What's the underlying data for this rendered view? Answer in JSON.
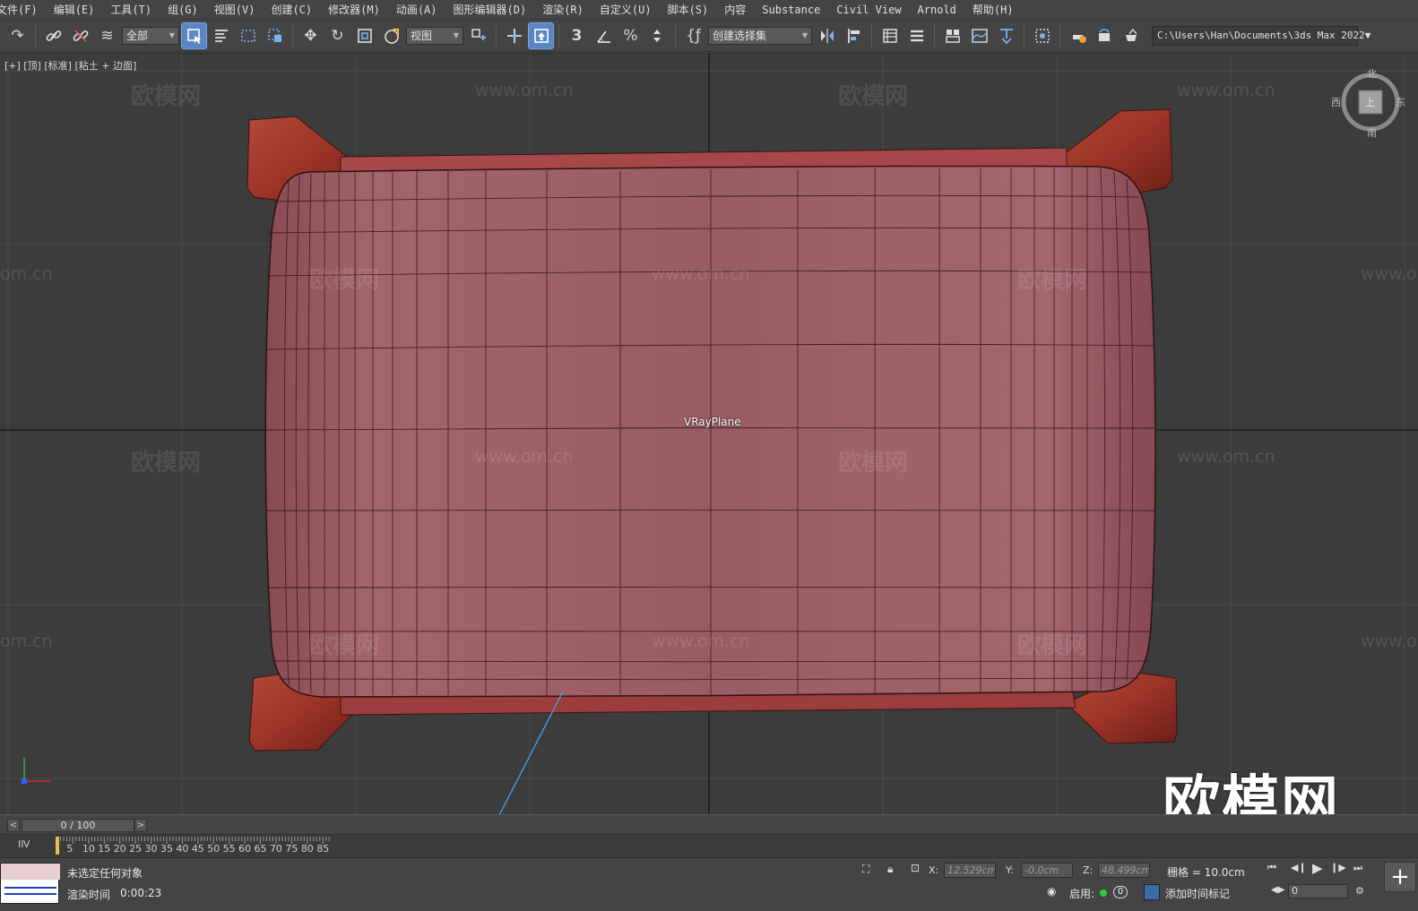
{
  "menu": [
    "文件(F)",
    "编辑(E)",
    "工具(T)",
    "组(G)",
    "视图(V)",
    "创建(C)",
    "修改器(M)",
    "动画(A)",
    "图形编辑器(D)",
    "渲染(R)",
    "自定义(U)",
    "脚本(S)",
    "内容",
    "Substance",
    "Civil View",
    "Arnold",
    "帮助(H)"
  ],
  "toolbar": {
    "filter_value": "全部",
    "ref_coord_value": "视图",
    "named_selection_value": "创建选择集",
    "project_path": "C:\\Users\\Han\\Documents\\3ds Max 2022",
    "snap_label": "3",
    "percent_label": "%"
  },
  "viewport": {
    "label": "[+] [顶] [标准] [粘土 + 边面]",
    "object_label": "VRayPlane",
    "watermark_brand": "欧模网",
    "watermark_url": "www.om.cn",
    "watermark_url_short": "om.cn",
    "big_watermark": "欧模网",
    "viewcube": {
      "north": "北",
      "south": "南",
      "east": "东",
      "west": "西",
      "face": "上"
    }
  },
  "timeline": {
    "frame_display": "0 / 100",
    "prev_symbol": "<",
    "next_symbol": ">",
    "ticks": [
      "5",
      "10",
      "15",
      "20",
      "25",
      "30",
      "35",
      "40",
      "45",
      "50",
      "55",
      "60",
      "65",
      "70",
      "75",
      "80",
      "85"
    ]
  },
  "status": {
    "selection": "未选定任何对象",
    "render_label": "渲染时间",
    "render_value": "0:00:23",
    "x_label": "X:",
    "x_value": "12.529cm",
    "y_label": "Y:",
    "y_value": "-0.0cm",
    "z_label": "Z:",
    "z_value": "48.499cm",
    "grid": "栅格 = 10.0cm",
    "enable_label": "启用:",
    "enable_value": "0",
    "add_time_tag": "添加时间标记",
    "current_frame": "0"
  },
  "colors": {
    "ui_bg": "#444444",
    "viewport_bg": "#3c3c3c",
    "cushion": "#9a5c63",
    "frame_wood": "#a2372b",
    "active_button": "#5b86c4"
  }
}
